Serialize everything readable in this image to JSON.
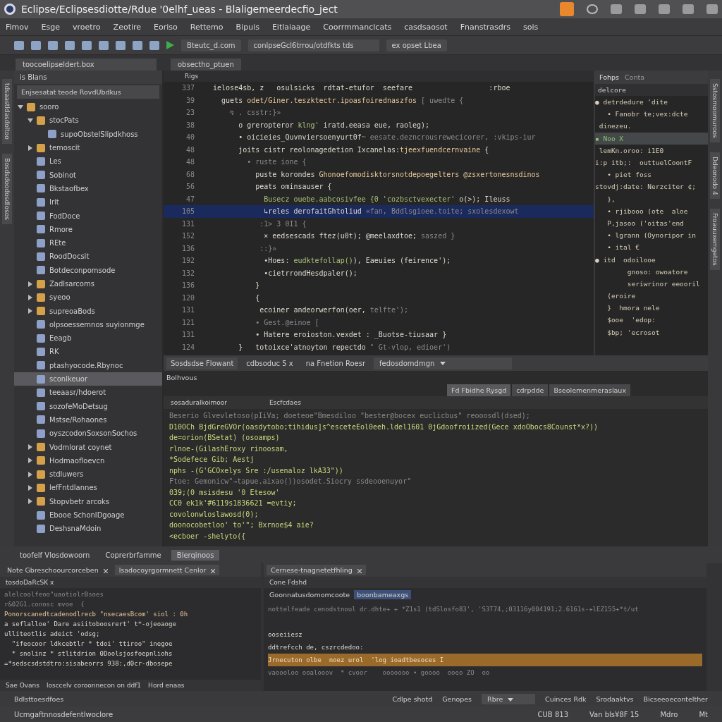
{
  "window": {
    "title": "Eclipse/Eclipsesdiotte/Rdue '0elhf_ueas - Blaligemeerdecfio_ject"
  },
  "menu": [
    "Fimov",
    "Esge",
    "vroetro",
    "Zeotire",
    "Eoriso",
    "Rettemo",
    "Bipuis",
    "Eitlaiaage",
    "Coorrmmanclcats",
    "casdsaosot",
    "Fnanstrasdrs",
    "sois"
  ],
  "toolbar": {
    "run_config": "Bteutc_d.com",
    "project_path": "conlpseGcl6trrou/otdfkts tds",
    "perspective": "ex opset Lbea"
  },
  "left_view": {
    "tab": "toocoelipseldert.box",
    "title": "is Blans",
    "filter": "Enjsesatat teode RovdUbdkus",
    "tree": [
      {
        "label": "sooro",
        "selected": false,
        "expanded": true,
        "children": [
          {
            "label": "stocPats",
            "selected": false,
            "expanded": true,
            "children": [
              {
                "label": "supoObstelSlipdkhoss",
                "selected": false
              }
            ]
          },
          {
            "label": "temoscit",
            "selected": false,
            "expanded": false
          },
          {
            "label": "Les",
            "selected": false
          },
          {
            "label": "Sobinot",
            "selected": false
          },
          {
            "label": "Bkstaofbex",
            "selected": false
          },
          {
            "label": "Irit",
            "selected": false
          },
          {
            "label": "FodDoce",
            "selected": false
          },
          {
            "label": "Rmore",
            "selected": false
          },
          {
            "label": "REte",
            "selected": false
          },
          {
            "label": "RoodDocsit",
            "selected": false
          },
          {
            "label": "Botdeconpomsode",
            "selected": false
          },
          {
            "label": "Zadlsarcoms",
            "selected": false,
            "expanded": false
          },
          {
            "label": "syeoo",
            "selected": false,
            "expanded": false
          },
          {
            "label": "supreoaBods",
            "selected": false,
            "expanded": false
          },
          {
            "label": "olpsoessemnos suyionmge",
            "selected": false
          },
          {
            "label": "Eeagb",
            "selected": false
          },
          {
            "label": "RK",
            "selected": false
          },
          {
            "label": "ptashyocode.Rbynoc",
            "selected": false
          },
          {
            "label": "sconlkeuor",
            "selected": true
          },
          {
            "label": "teeaasr/hdoerot",
            "selected": false
          },
          {
            "label": "sozofeMoDetsug",
            "selected": false
          },
          {
            "label": "Mstse/Rohaones",
            "selected": false
          },
          {
            "label": "oyszcodonSoxsonSochos",
            "selected": false
          },
          {
            "label": "Vodmlorat coynet",
            "selected": false,
            "expanded": false
          },
          {
            "label": "Hodmaofloevcn",
            "selected": false,
            "expanded": false
          },
          {
            "label": "stdluwers",
            "selected": false,
            "expanded": false
          },
          {
            "label": "lefFntdlannes",
            "selected": false,
            "expanded": false
          },
          {
            "label": "Stopvbetr arcoks",
            "selected": false,
            "expanded": false
          },
          {
            "label": "Ebooe SchonlDgoage",
            "selected": false
          },
          {
            "label": "DeshsnaMdoin",
            "selected": false
          }
        ]
      }
    ]
  },
  "left_strip": [
    "tdsaastldasdoltoo",
    "Bosdsdoodosdlosos"
  ],
  "editor": {
    "tab": "obsectho_ptuen",
    "breadcrumb": "Rigs",
    "lines": [
      {
        "number": "337",
        "selected": false,
        "segments": [
          {
            "kind": "plain",
            "text": "  ielose4sb, z   osulsicks  rdtat-etufor  seefare                  :rboe"
          }
        ]
      },
      {
        "number": "39",
        "selected": false,
        "segments": [
          {
            "kind": "plain",
            "text": "    guets "
          },
          {
            "kind": "key",
            "text": "odet/Giner.teszktectr.ipoasfoirednaszfos"
          },
          {
            "kind": "dim",
            "text": " [ uwedte {"
          }
        ]
      },
      {
        "number": "23",
        "selected": false,
        "segments": [
          {
            "kind": "dim",
            "text": "      ↯ . csstr:}»"
          }
        ]
      },
      {
        "number": "38",
        "selected": false,
        "segments": [
          {
            "kind": "plain",
            "text": "        o greropteror "
          },
          {
            "kind": "str",
            "text": "klng'"
          },
          {
            "kind": "plain",
            "text": " iratd.eeasa eue, raoleg);"
          }
        ]
      },
      {
        "number": "40",
        "selected": false,
        "segments": [
          {
            "kind": "plain",
            "text": "        • oicieies_Quvnviersoenyurt0f"
          },
          {
            "kind": "dim",
            "text": "~ eesate.dezncrousrewecicorer, :vkips-iur"
          }
        ]
      },
      {
        "number": "48",
        "selected": false,
        "segments": [
          {
            "kind": "plain",
            "text": "        joits cistr reolonagedetion Ixcanelas:"
          },
          {
            "kind": "key",
            "text": "tjeexfuendcernvaine"
          },
          {
            "kind": "plain",
            "text": " {"
          }
        ]
      },
      {
        "number": "48",
        "selected": false,
        "segments": [
          {
            "kind": "dim",
            "text": "          • ruste ione {"
          }
        ]
      },
      {
        "number": "68",
        "selected": false,
        "segments": [
          {
            "kind": "plain",
            "text": "            puste korondes "
          },
          {
            "kind": "key",
            "text": "Ghonoefomodisktorsnotdepoegelters @zsxertonesnsdinos"
          }
        ]
      },
      {
        "number": "56",
        "selected": false,
        "segments": [
          {
            "kind": "plain",
            "text": "            peats ominsauser {"
          }
        ]
      },
      {
        "number": "47",
        "selected": false,
        "segments": [
          {
            "kind": "str",
            "text": "              Busecz ouebe.aabcosivfee {0 'cozbsctvexecter'"
          },
          {
            "kind": "plain",
            "text": " o(>); Ileuss"
          }
        ]
      },
      {
        "number": "105",
        "selected": true,
        "segments": [
          {
            "kind": "plain",
            "text": "              ↳reles derofaitGhtoliud "
          },
          {
            "kind": "dim",
            "text": "«fan, Bddlsgioee.toite; sxolesdexowt"
          }
        ]
      },
      {
        "number": "131",
        "selected": false,
        "segments": [
          {
            "kind": "dim",
            "text": "             :1> 3 0I1 {"
          }
        ]
      },
      {
        "number": "152",
        "selected": false,
        "segments": [
          {
            "kind": "plain",
            "text": "              × eedsescads ftez(u0t); @meelaxdtoe; "
          },
          {
            "kind": "dim",
            "text": "saszed }"
          }
        ]
      },
      {
        "number": "136",
        "selected": false,
        "segments": [
          {
            "kind": "dim",
            "text": "             ::}»"
          }
        ]
      },
      {
        "number": "192",
        "selected": false,
        "segments": [
          {
            "kind": "plain",
            "text": "              •Hoes: "
          },
          {
            "kind": "str",
            "text": "eudktefollap()"
          },
          {
            "kind": "plain",
            "text": "), Eaeuies (feirence');"
          }
        ]
      },
      {
        "number": "132",
        "selected": false,
        "segments": [
          {
            "kind": "plain",
            "text": "              •cietrrondHesdpaler();"
          }
        ]
      },
      {
        "number": "136",
        "selected": false,
        "segments": [
          {
            "kind": "plain",
            "text": "            }"
          }
        ]
      },
      {
        "number": "120",
        "selected": false,
        "segments": [
          {
            "kind": "plain",
            "text": "            {"
          }
        ]
      },
      {
        "number": "131",
        "selected": false,
        "segments": [
          {
            "kind": "plain",
            "text": "             ecoiner andeorwerfon(oer, "
          },
          {
            "kind": "dim",
            "text": "telfte');"
          }
        ]
      },
      {
        "number": "121",
        "selected": false,
        "segments": [
          {
            "kind": "dim",
            "text": "            • Gest.@einoe ["
          }
        ]
      },
      {
        "number": "131",
        "selected": false,
        "segments": [
          {
            "kind": "plain",
            "text": "            • Hatere eroioston.vexdet : _Buotse-tiusaar }"
          }
        ]
      },
      {
        "number": "124",
        "selected": false,
        "segments": [
          {
            "kind": "plain",
            "text": "        }   totoixce'atnoyton repectdo ' "
          },
          {
            "kind": "dim",
            "text": "Gt-vlop, edioer')"
          }
        ]
      }
    ]
  },
  "outline": {
    "tabs": [
      {
        "label": "Fohps",
        "selected": true
      },
      {
        "label": "Conta",
        "selected": false
      }
    ],
    "header": "delcore",
    "lines": [
      {
        "text": "● detrdedure 'dite",
        "selected": false
      },
      {
        "text": "   • Fanobr te;vex:dcte",
        "selected": false
      },
      {
        "text": " dinezeu.",
        "selected": false
      },
      {
        "text": "▪ Noo X",
        "selected": true
      },
      {
        "text": " lemKn.oroo: i1E0",
        "selected": false
      },
      {
        "text": "i:p itb;:  outtuelCoontF",
        "selected": false
      },
      {
        "text": "   • piet foss",
        "selected": false
      },
      {
        "text": "stovdj:date: Nerzciter ¢;",
        "selected": false
      },
      {
        "text": "   },",
        "selected": false
      },
      {
        "text": "   • rjibooo (ote  aloe",
        "selected": false
      },
      {
        "text": "   P,jasoo ('oitas'end",
        "selected": false
      },
      {
        "text": "   • lgrann (Oynoripor in",
        "selected": false
      },
      {
        "text": "   • ital €",
        "selected": false
      },
      {
        "text": "● itd  odoilooe",
        "selected": false
      },
      {
        "text": "        gnoso: owoatore",
        "selected": false
      },
      {
        "text": "        seriwrinor eeooril",
        "selected": false
      },
      {
        "text": "   (eroire",
        "selected": false
      },
      {
        "text": "   }  hmora nele",
        "selected": false
      },
      {
        "text": "   $ooe  'edop:",
        "selected": false
      },
      {
        "text": "   $bp; 'ecrosot",
        "selected": false
      }
    ]
  },
  "right_strip": [
    "Sstosmoomuroos",
    "Ddeonodo 4",
    "Froauuxemgetos"
  ],
  "console": {
    "tabs": [
      {
        "label": "Sosdsdse Flowant",
        "selected": true
      },
      {
        "label": "cdbsoduc 5 x",
        "selected": false
      },
      {
        "label": "na Fnetion Roesr",
        "selected": false
      }
    ],
    "dropdown": "fedosdomdmgn",
    "subtitle": "Bolhvous",
    "actions": [
      {
        "label": "Fd Fbidhe Rysgd",
        "selected": true
      },
      {
        "label": "cdrpdde",
        "selected": false
      },
      {
        "label": "Bseolemenmeraslaux",
        "selected": false
      }
    ],
    "filter_tabs": [
      "sosaduralkoimoor",
      "Escfcdaes"
    ],
    "lines": [
      {
        "kind": "dim",
        "text": "Beserio Glvevletoso(pIiVa; doeteoe\"Bmesdiloo \"bester@bocex euclicbus\" reooosdl(dsed);"
      },
      {
        "kind": "out",
        "text": "D10OCh BjdGreGVOr(oasdytobo;tihidus]s^esceteEol0eeh.ldel1601 0jGdoofroiized(Gece xdoObocs8Counst*x?))"
      },
      {
        "kind": "out",
        "text": "de=orion(BSetat) (osoamps)"
      },
      {
        "kind": "out",
        "text": "rlnoe-(GilashEroxy rinoosam,"
      },
      {
        "kind": "out",
        "text": "*Sodefece Gib; Aestj"
      },
      {
        "kind": "out",
        "text": "nphs -(G'GCOxelys Sre :/usenaloz lkA33\"))"
      },
      {
        "kind": "dim",
        "text": "Ftoe: Gemonicw\"→tapue.aixao())osodet.Siocry ssdeooenuyor\""
      },
      {
        "kind": "out",
        "text": "039;(0 msisdesu '0 Etesow'"
      },
      {
        "kind": "out",
        "text": "CC0 ek1k'#6119s1836621 =evtiy;"
      },
      {
        "kind": "out",
        "text": "covolonwloslawosd(0);"
      },
      {
        "kind": "out",
        "text": "doonocobetloo' to'\"; Bxrnoe$4 aie?"
      },
      {
        "kind": "out",
        "text": "<ecboer -shelyto({"
      }
    ]
  },
  "bottom": {
    "tabs": [
      {
        "label": "toofelf Vlosdowoorn",
        "selected": false
      },
      {
        "label": "Coprerbrfamme",
        "selected": false
      },
      {
        "label": "Blerqinoos",
        "selected": true
      }
    ],
    "left": {
      "tabs": [
        {
          "label": "Note Gbreschoourcorceben",
          "selected": false
        },
        {
          "label": "lsadocoyrgormnett Cenlor",
          "selected": true
        }
      ],
      "subtitle": "tosdoDaRcSK x",
      "lines": [
        {
          "kind": "dim",
          "text": "alelcoolfeoo\"uaotiolrBsoes"
        },
        {
          "kind": "dim",
          "text": "r&02G1.conosc mvoe  {"
        },
        {
          "kind": "key",
          "text": "Ponorscanedtcadenodlrecb \"nsecaesBcom' siol : 0h"
        },
        {
          "kind": "plain",
          "text": "a seflalloe' Dare asiitoboosrert' t*-ojeoaoge"
        },
        {
          "kind": "plain",
          "text": "ulliteotlis adeict 'odsg;"
        },
        {
          "kind": "plain",
          "text": "  \"ifeocoor ldkcebtlr * tdoi' ttiroo\" inegoe"
        },
        {
          "kind": "plain",
          "text": "  * snolinz * stlitdrion 0Doolsjosfoepnliohs"
        },
        {
          "kind": "plain",
          "text": "=*sedscsdstdtro:sisabeorrs 938:,d0cr-dbosepe"
        }
      ],
      "footer": [
        "Sae Ovans",
        "losccelv coroonnecon on ddf1",
        "Hord enaas"
      ]
    },
    "right": {
      "tab": "Cernese-tnagnetetfhling",
      "subtitle": "Cone Fdshd",
      "path": "Goonnatusdomomcoote",
      "chip": "boonbameaxgs",
      "lines": [
        {
          "kind": "dim",
          "text": "nottelfeade cenodstnoul dr.dhte+ + *Z1s1 (tdSlosfo83', 'S3T74,;03116y004191;2.6161s-+lEZ155+*t/ut"
        },
        {
          "kind": "gap",
          "text": "ooseiiesz"
        },
        {
          "kind": "plain",
          "text": "ddtrefcch de, cszrcdedoo:"
        },
        {
          "kind": "warn",
          "text": "Jrnecuton olbe  noez urol  'log ioadtbesoces I"
        },
        {
          "kind": "dim",
          "text": "vaoooloo ooalooov  * cvoor    ooooooo • goooo  ooeo ZO  oo"
        }
      ]
    },
    "toolbar": {
      "left": "Bdlsttoesdfoes",
      "items": [
        "Cdlpe shotd",
        "Genopes"
      ],
      "dropdown": "Rbre",
      "more": [
        "Cuinces Rdk",
        "Srodaaktvs",
        "Bicseeoecontelther"
      ]
    }
  },
  "status_bar": {
    "message": "Ucmgaftnnosdefentlwoclore",
    "items": [
      "CUB 813",
      "Van bls¥8F 15",
      "Mdro",
      "Mt"
    ]
  }
}
